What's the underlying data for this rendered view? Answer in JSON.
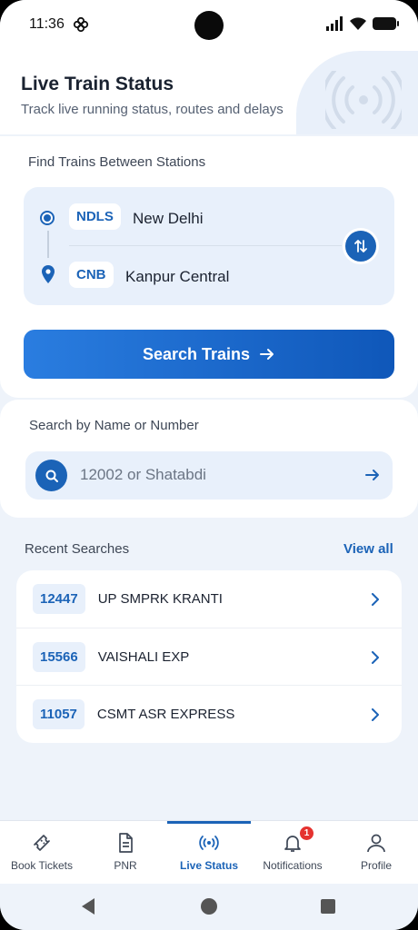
{
  "status_bar": {
    "time": "11:36"
  },
  "header": {
    "title": "Live Train Status",
    "subtitle": "Track live running status, routes and delays"
  },
  "between_stations": {
    "label": "Find Trains Between Stations",
    "from": {
      "code": "NDLS",
      "name": "New Delhi"
    },
    "to": {
      "code": "CNB",
      "name": "Kanpur Central"
    },
    "search_button": "Search Trains"
  },
  "search_by_name": {
    "label": "Search by Name or Number",
    "placeholder": "12002 or Shatabdi"
  },
  "recent": {
    "title": "Recent Searches",
    "view_all": "View all",
    "items": [
      {
        "number": "12447",
        "name": "UP SMPRK KRANTI"
      },
      {
        "number": "15566",
        "name": "VAISHALI EXP"
      },
      {
        "number": "11057",
        "name": "CSMT ASR EXPRESS"
      }
    ]
  },
  "bottom_nav": {
    "items": [
      {
        "label": "Book Tickets",
        "icon": "ticket-icon"
      },
      {
        "label": "PNR",
        "icon": "document-icon"
      },
      {
        "label": "Live Status",
        "icon": "broadcast-icon",
        "active": true
      },
      {
        "label": "Notifications",
        "icon": "bell-icon",
        "badge": "1"
      },
      {
        "label": "Profile",
        "icon": "person-icon"
      }
    ]
  },
  "colors": {
    "primary": "#1b63b7",
    "background": "#eef3fa",
    "badge": "#e5322f"
  }
}
